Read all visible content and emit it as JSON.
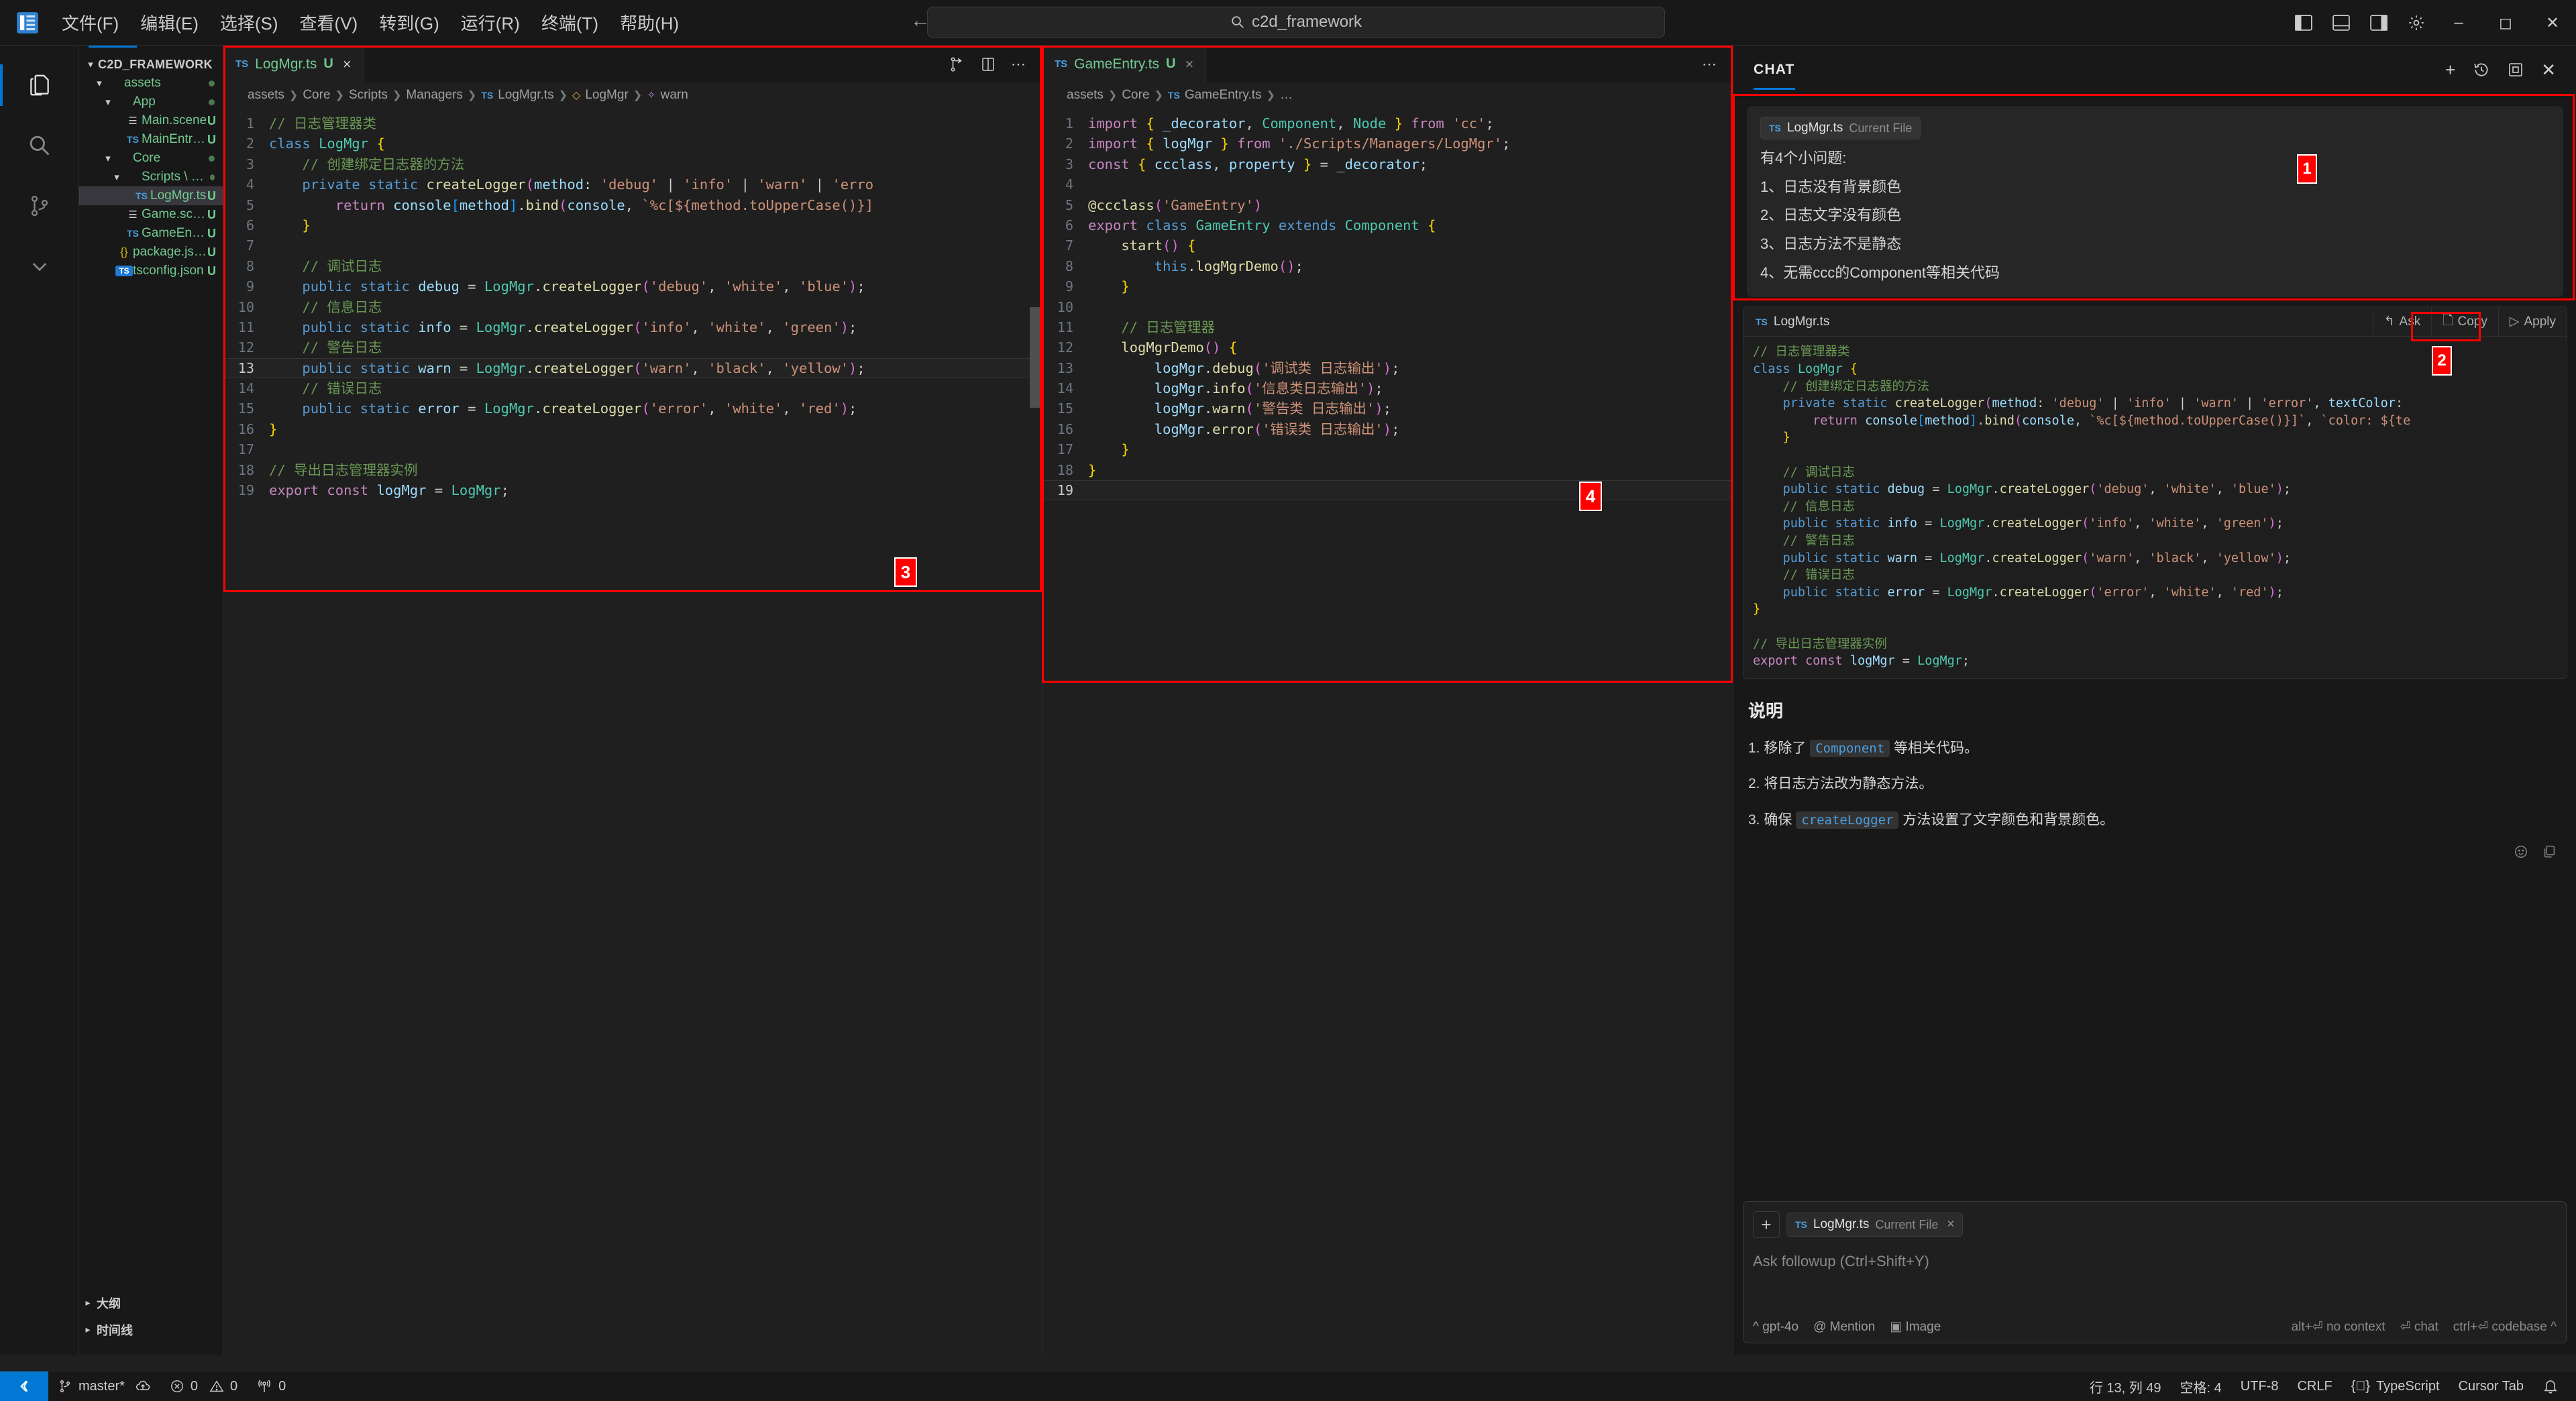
{
  "titlebar": {
    "menus": [
      "文件(F)",
      "编辑(E)",
      "选择(S)",
      "查看(V)",
      "转到(G)",
      "运行(R)",
      "终端(T)",
      "帮助(H)"
    ],
    "search_value": "c2d_framework",
    "search_icon": "search-icon",
    "back_icon": "←",
    "forward_icon": "→",
    "right_icons": [
      "panel-left-icon",
      "panel-bottom-icon",
      "panel-right-icon",
      "settings-gear-icon"
    ],
    "window_controls": [
      "minimize",
      "maximize",
      "close"
    ]
  },
  "activitybar": {
    "items": [
      {
        "name": "explorer",
        "glyph": "files-icon"
      },
      {
        "name": "search",
        "glyph": "search-icon"
      },
      {
        "name": "source-control",
        "glyph": "git-branch-icon"
      },
      {
        "name": "more",
        "glyph": "chevron-down-icon"
      }
    ]
  },
  "explorer": {
    "root": "C2D_FRAMEWORK",
    "tree": [
      {
        "label": "assets",
        "indent": 1,
        "type": "folder",
        "expanded": true,
        "badge": "dot"
      },
      {
        "label": "App",
        "indent": 2,
        "type": "folder",
        "expanded": true,
        "badge": "dot"
      },
      {
        "label": "Main.scene",
        "indent": 3,
        "type": "scene",
        "badge": "U"
      },
      {
        "label": "MainEntry.ts",
        "indent": 3,
        "type": "ts",
        "badge": "U"
      },
      {
        "label": "Core",
        "indent": 2,
        "type": "folder",
        "expanded": true,
        "badge": "dot"
      },
      {
        "label": "Scripts \\ Man…",
        "indent": 3,
        "type": "folder",
        "expanded": true,
        "badge": "dot"
      },
      {
        "label": "LogMgr.ts",
        "indent": 4,
        "type": "ts",
        "badge": "U",
        "selected": true
      },
      {
        "label": "Game.scene",
        "indent": 3,
        "type": "scene",
        "badge": "U"
      },
      {
        "label": "GameEntry.ts",
        "indent": 3,
        "type": "ts",
        "badge": "U"
      },
      {
        "label": "package.json",
        "indent": 2,
        "type": "json",
        "badge": "U"
      },
      {
        "label": "tsconfig.json",
        "indent": 2,
        "type": "tsjson",
        "badge": "U"
      }
    ],
    "sections": [
      {
        "label": "大纲",
        "expanded": false
      },
      {
        "label": "时间线",
        "expanded": false
      }
    ]
  },
  "editor1": {
    "tab": {
      "name": "LogMgr.ts",
      "dirty_badge": "U",
      "icon": "TS",
      "close": "×"
    },
    "tab_actions": [
      "split-editor-icon",
      "layout-icon",
      "more-actions-icon"
    ],
    "breadcrumb": [
      "assets",
      "Core",
      "Scripts",
      "Managers",
      "LogMgr.ts",
      "LogMgr",
      "warn"
    ],
    "lines": [
      {
        "n": 1,
        "code": "// 日志管理器类"
      },
      {
        "n": 2,
        "code": "class LogMgr {"
      },
      {
        "n": 3,
        "code": "    // 创建绑定日志器的方法"
      },
      {
        "n": 4,
        "code": "    private static createLogger(method: 'debug' | 'info' | 'warn' | 'erro"
      },
      {
        "n": 5,
        "code": "        return console[method].bind(console, `%c[${method.toUpperCase()}]"
      },
      {
        "n": 6,
        "code": "    }"
      },
      {
        "n": 7,
        "code": ""
      },
      {
        "n": 8,
        "code": "    // 调试日志"
      },
      {
        "n": 9,
        "code": "    public static debug = LogMgr.createLogger('debug', 'white', 'blue');"
      },
      {
        "n": 10,
        "code": "    // 信息日志"
      },
      {
        "n": 11,
        "code": "    public static info = LogMgr.createLogger('info', 'white', 'green');"
      },
      {
        "n": 12,
        "code": "    // 警告日志"
      },
      {
        "n": 13,
        "code": "    public static warn = LogMgr.createLogger('warn', 'black', 'yellow');",
        "current": true
      },
      {
        "n": 14,
        "code": "    // 错误日志"
      },
      {
        "n": 15,
        "code": "    public static error = LogMgr.createLogger('error', 'white', 'red');"
      },
      {
        "n": 16,
        "code": "}"
      },
      {
        "n": 17,
        "code": ""
      },
      {
        "n": 18,
        "code": "// 导出日志管理器实例"
      },
      {
        "n": 19,
        "code": "export const logMgr = LogMgr;"
      }
    ],
    "annotation": "3"
  },
  "editor2": {
    "tab": {
      "name": "GameEntry.ts",
      "dirty_badge": "U",
      "icon": "TS",
      "close": "×"
    },
    "tab_actions": [
      "more-actions-icon"
    ],
    "breadcrumb": [
      "assets",
      "Core",
      "GameEntry.ts",
      "…"
    ],
    "lines": [
      {
        "n": 1,
        "code": "import { _decorator, Component, Node } from 'cc';"
      },
      {
        "n": 2,
        "code": "import { logMgr } from './Scripts/Managers/LogMgr';"
      },
      {
        "n": 3,
        "code": "const { ccclass, property } = _decorator;"
      },
      {
        "n": 4,
        "code": ""
      },
      {
        "n": 5,
        "code": "@ccclass('GameEntry')"
      },
      {
        "n": 6,
        "code": "export class GameEntry extends Component {"
      },
      {
        "n": 7,
        "code": "    start() {"
      },
      {
        "n": 8,
        "code": "        this.logMgrDemo();"
      },
      {
        "n": 9,
        "code": "    }"
      },
      {
        "n": 10,
        "code": ""
      },
      {
        "n": 11,
        "code": "    // 日志管理器"
      },
      {
        "n": 12,
        "code": "    logMgrDemo() {"
      },
      {
        "n": 13,
        "code": "        logMgr.debug('调试类 日志输出');"
      },
      {
        "n": 14,
        "code": "        logMgr.info('信息类日志输出');"
      },
      {
        "n": 15,
        "code": "        logMgr.warn('警告类 日志输出');"
      },
      {
        "n": 16,
        "code": "        logMgr.error('错误类 日志输出');"
      },
      {
        "n": 17,
        "code": "    }"
      },
      {
        "n": 18,
        "code": "}"
      },
      {
        "n": 19,
        "code": "",
        "current": true
      }
    ],
    "annotation": "4"
  },
  "chat": {
    "title": "CHAT",
    "header_icons": [
      "new-chat-icon",
      "history-icon",
      "maximize-panel-icon",
      "close-icon"
    ],
    "user_message": {
      "chip_file": "LogMgr.ts",
      "chip_suffix": "Current File",
      "lines": [
        "有4个小问题:",
        "1、日志没有背景颜色",
        "2、日志文字没有颜色",
        "3、日志方法不是静态",
        "4、无需ccc的Component等相关代码"
      ],
      "annotation": "1"
    },
    "codeblock": {
      "title": "LogMgr.ts",
      "icon": "TS",
      "actions": [
        {
          "label": "Ask",
          "icon": "ask-icon"
        },
        {
          "label": "Copy",
          "icon": "copy-icon",
          "annotated": true
        },
        {
          "label": "Apply",
          "icon": "apply-icon"
        }
      ],
      "annotation": "2",
      "lines": [
        "// 日志管理器类",
        "class LogMgr {",
        "    // 创建绑定日志器的方法",
        "    private static createLogger(method: 'debug' | 'info' | 'warn' | 'error', textColor: ",
        "        return console[method].bind(console, `%c[${method.toUpperCase()}]`, `color: ${te",
        "    }",
        "",
        "    // 调试日志",
        "    public static debug = LogMgr.createLogger('debug', 'white', 'blue');",
        "    // 信息日志",
        "    public static info = LogMgr.createLogger('info', 'white', 'green');",
        "    // 警告日志",
        "    public static warn = LogMgr.createLogger('warn', 'black', 'yellow');",
        "    // 错误日志",
        "    public static error = LogMgr.createLogger('error', 'white', 'red');",
        "}",
        "",
        "// 导出日志管理器实例",
        "export const logMgr = LogMgr;"
      ]
    },
    "explanation": {
      "title": "说明",
      "items": [
        {
          "prefix": "1. 移除了 ",
          "code": "Component",
          "suffix": " 等相关代码。"
        },
        {
          "prefix": "2. 将日志方法改为静态方法。",
          "code": "",
          "suffix": ""
        },
        {
          "prefix": "3. 确保 ",
          "code": "createLogger",
          "suffix": " 方法设置了文字颜色和背景颜色。"
        }
      ]
    },
    "footer_icons": [
      "thumbs-up-icon",
      "copy-icon"
    ],
    "input": {
      "plus": "+",
      "chip_file": "LogMgr.ts",
      "chip_suffix": "Current File",
      "chip_close": "×",
      "placeholder": "Ask followup (Ctrl+Shift+Y)",
      "model": "gpt-4o",
      "mention": "Mention",
      "image": "Image",
      "hint_no_context": "alt+⏎ no context",
      "hint_chat": "⏎ chat",
      "hint_codebase": "ctrl+⏎ codebase"
    }
  },
  "statusbar": {
    "remote_icon": "remote-indicator-icon",
    "branch": "master*",
    "sync_icon": "cloud-upload-icon",
    "errors": "0",
    "warnings": "0",
    "ports": "0",
    "cursor_position": "行 13, 列 49",
    "indentation": "空格: 4",
    "encoding": "UTF-8",
    "eol": "CRLF",
    "language": "TypeScript",
    "cursor_tab": "Cursor Tab",
    "bell_icon": "bell-icon"
  },
  "colors": {
    "accent": "#0078d4",
    "annotation_red": "#ff0000",
    "bg": "#1f1f1f",
    "panel_bg": "#181818",
    "green_modified": "#73c991"
  }
}
